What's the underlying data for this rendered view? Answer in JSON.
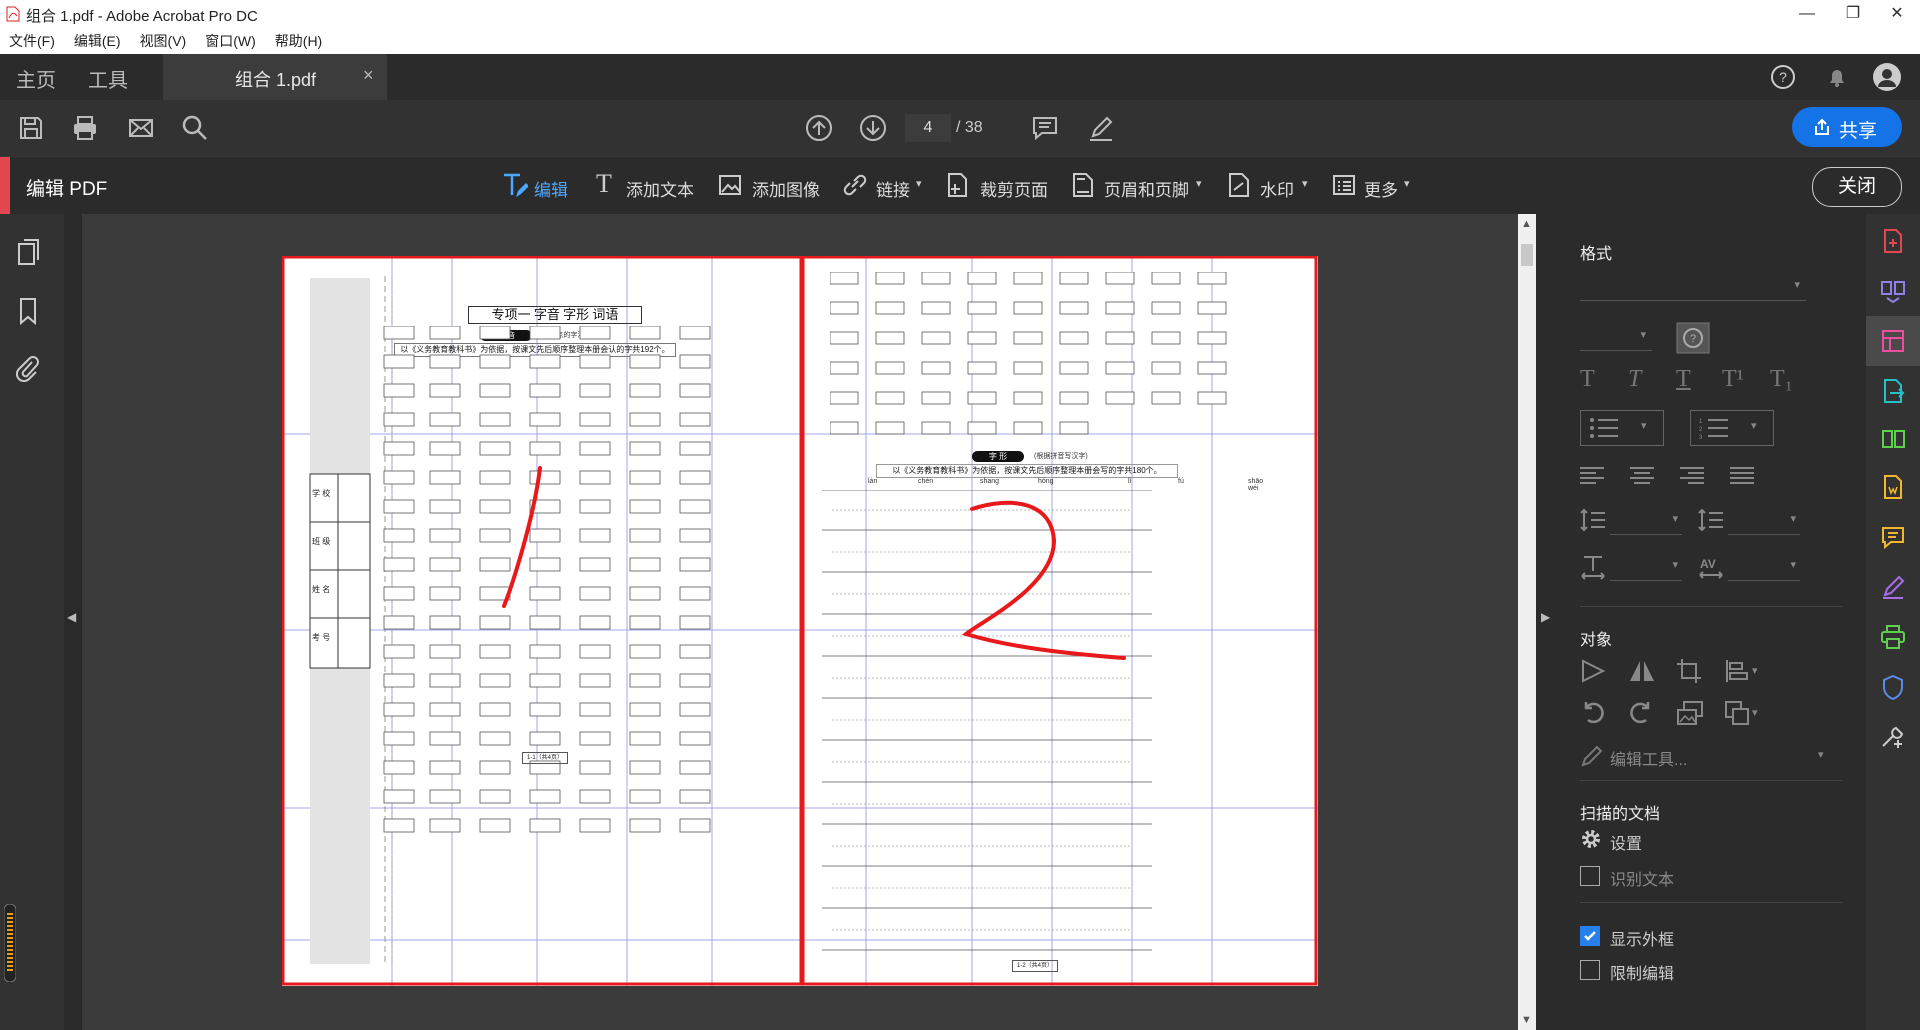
{
  "window": {
    "title": "组合 1.pdf - Adobe Acrobat Pro DC",
    "minimize": "—",
    "maximize": "❐",
    "close": "✕"
  },
  "menu": [
    "文件(F)",
    "编辑(E)",
    "视图(V)",
    "窗口(W)",
    "帮助(H)"
  ],
  "tabs": {
    "home": "主页",
    "tools": "工具",
    "document": "组合 1.pdf",
    "close": "×"
  },
  "toolbar": {
    "current_page": "4",
    "total_pages": "/ 38",
    "share": "共享"
  },
  "edit_pdf": {
    "title": "编辑 PDF",
    "tools": [
      "编辑",
      "添加文本",
      "添加图像",
      "链接",
      "裁剪页面",
      "页眉和页脚",
      "水印",
      "更多"
    ],
    "close": "关闭"
  },
  "format_panel": {
    "heading": "格式",
    "objects_heading": "对象",
    "edit_tool": "编辑工具...",
    "scanned_heading": "扫描的文档",
    "settings": "设置",
    "recognize_text": "识别文本",
    "show_bbox": "显示外框",
    "restrict_edit": "限制编辑",
    "show_bbox_checked": true,
    "restrict_edit_checked": false
  },
  "page_content": {
    "left": {
      "title": "专项一  字音  字形  词语",
      "pill": "字 音",
      "pill_note": "(给加点的字注音)",
      "intro": "以《义务教育教科书》为依据，按课文先后顺序整理本册会认的字共192个。",
      "side_labels": [
        "学 校",
        "班 级",
        "姓 名",
        "考 号"
      ],
      "footer": "1-1（共4页）"
    },
    "right": {
      "pill": "字 形",
      "pill_note": "(根据拼音写汉字)",
      "intro": "以《义务教育教科书》为依据，按课文先后顺序整理本册会写的字共180个。",
      "pinyin_row1": [
        "lán",
        "chén",
        "shang",
        "hóng",
        "",
        "lì",
        "fú",
        "",
        "shāo wéi"
      ],
      "footer": "1-2（共4页）"
    }
  },
  "colors": {
    "accent_red": "#e34850",
    "share_blue": "#1473e6",
    "annotation_red": "#e8191b"
  }
}
